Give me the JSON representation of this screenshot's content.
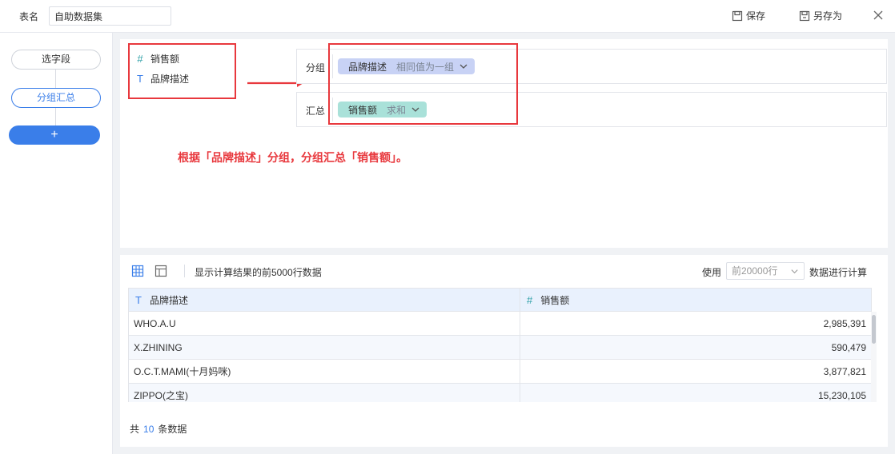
{
  "header": {
    "table_name_label": "表名",
    "table_name_value": "自助数据集",
    "save_label": "保存",
    "save_as_label": "另存为"
  },
  "sidebar": {
    "steps": [
      {
        "label": "选字段"
      },
      {
        "label": "分组汇总"
      }
    ],
    "add_label": "+"
  },
  "fields": [
    {
      "type_glyph": "#",
      "name": "销售额"
    },
    {
      "type_glyph": "T",
      "name": "品牌描述"
    }
  ],
  "group": {
    "label": "分组",
    "chip_name": "品牌描述",
    "chip_mode": "相同值为一组"
  },
  "summary": {
    "label": "汇总",
    "chip_name": "销售额",
    "chip_mode": "求和"
  },
  "annotation": "根据「品牌描述」分组，分组汇总「销售额」。",
  "preview": {
    "note": "显示计算结果的前5000行数据",
    "use_label": "使用",
    "row_limit": "前20000行",
    "use_suffix": "数据进行计算",
    "columns": [
      {
        "type_glyph": "T",
        "name": "品牌描述"
      },
      {
        "type_glyph": "#",
        "name": "销售额"
      }
    ],
    "rows": [
      {
        "brand": "WHO.A.U",
        "sales": "2,985,391"
      },
      {
        "brand": "X.ZHINING",
        "sales": "590,479"
      },
      {
        "brand": "O.C.T.MAMI(十月妈咪)",
        "sales": "3,877,821"
      },
      {
        "brand": "ZIPPO(之宝)",
        "sales": "15,230,105"
      }
    ],
    "total_prefix": "共",
    "total_count": "10",
    "total_suffix": "条数据"
  },
  "colors": {
    "accent": "#3a7ee9",
    "annotation_red": "#e8383d",
    "group_chip": "#c8d2f5",
    "sum_chip": "#a9e1d9"
  }
}
